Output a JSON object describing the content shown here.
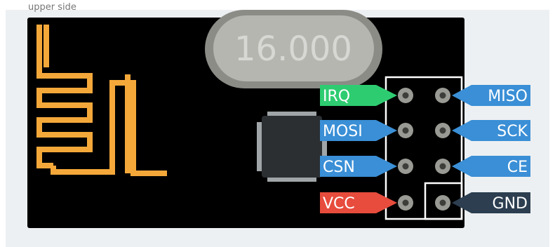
{
  "caption": "upper side",
  "crystal": {
    "label": "16.000"
  },
  "pins": [
    {
      "label": "IRQ",
      "side": "left",
      "color": "#2ecc71"
    },
    {
      "label": "MISO",
      "side": "right",
      "color": "#3a8fd6"
    },
    {
      "label": "MOSI",
      "side": "left",
      "color": "#3a8fd6"
    },
    {
      "label": "SCK",
      "side": "right",
      "color": "#3a8fd6"
    },
    {
      "label": "CSN",
      "side": "left",
      "color": "#3a8fd6"
    },
    {
      "label": "CE",
      "side": "right",
      "color": "#3a8fd6"
    },
    {
      "label": "VCC",
      "side": "left",
      "color": "#e74c3c"
    },
    {
      "label": "GND",
      "side": "right",
      "color": "#2c3e50"
    }
  ],
  "colors": {
    "background": "#edf0f2",
    "board": "#000000",
    "antenna": "#f5a83a",
    "crystal_body": "#b0b0ab",
    "chip": "#2b2f32",
    "header_frame": "#ffffff",
    "pin_pad": "#9a9a94"
  }
}
